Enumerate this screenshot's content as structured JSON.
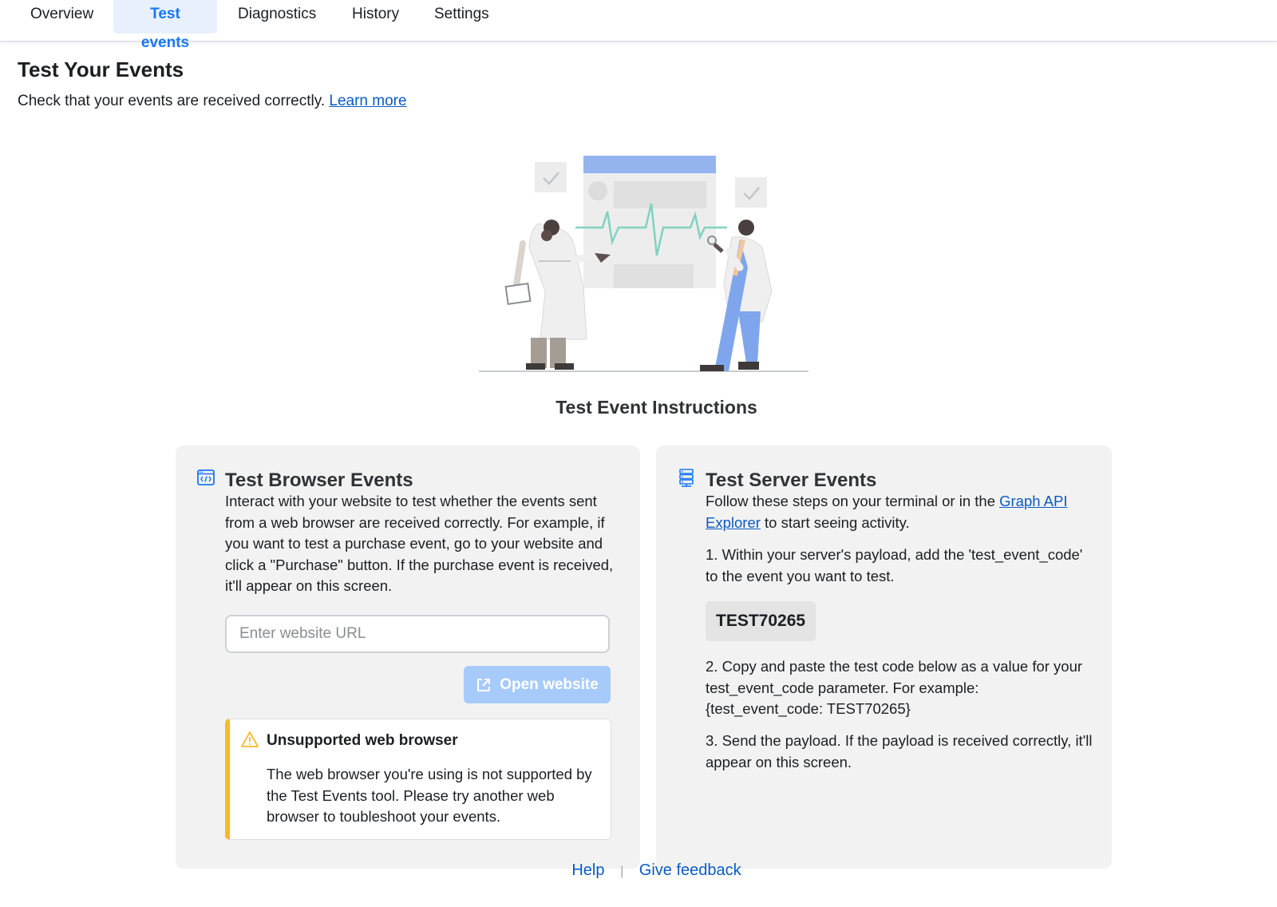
{
  "tabs": [
    {
      "label": "Overview",
      "active": false
    },
    {
      "label": "Test events",
      "active": true
    },
    {
      "label": "Diagnostics",
      "active": false
    },
    {
      "label": "History",
      "active": false
    },
    {
      "label": "Settings",
      "active": false
    }
  ],
  "header": {
    "title": "Test Your Events",
    "subtitle": "Check that your events are received correctly.",
    "learn_more": "Learn more"
  },
  "instructions_title": "Test Event Instructions",
  "browser_card": {
    "icon": "code-window-icon",
    "title": "Test Browser Events",
    "description": "Interact with your website to test whether the events sent from a web browser are received correctly. For example, if you want to test a purchase event, go to your website and click a \"Purchase\" button. If the purchase event is received, it'll appear on this screen.",
    "url_placeholder": "Enter website URL",
    "url_value": "",
    "open_button": "Open website",
    "warning": {
      "icon": "warning-icon",
      "title": "Unsupported web browser",
      "text": "The web browser you're using is not supported by the Test Events tool. Please try another web browser to toubleshoot your events."
    }
  },
  "server_card": {
    "icon": "server-icon",
    "title": "Test Server Events",
    "intro_before": "Follow these steps on your terminal or in the",
    "intro_link": "Graph API Explorer",
    "intro_after": "to start seeing activity.",
    "step1": "1. Within your server's payload, add the 'test_event_code' to the event you want to test.",
    "code": "TEST70265",
    "step2": "2. Copy and paste the test code below as a value for your test_event_code parameter. For example: {test_event_code: TEST70265}",
    "step3": "3. Send the payload. If the payload is received correctly, it'll appear on this screen."
  },
  "footer": {
    "help": "Help",
    "separator": "|",
    "feedback": "Give feedback"
  },
  "colors": {
    "accent": "#1877f2",
    "link": "#0a5ac2",
    "warning": "#f7b928",
    "card_bg": "#f2f2f2",
    "button_disabled": "#a6cbfa"
  }
}
